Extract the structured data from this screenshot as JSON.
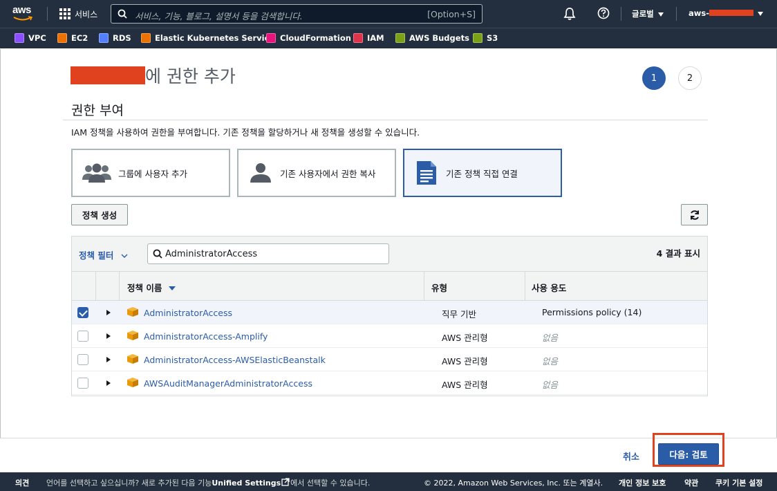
{
  "topnav": {
    "logo_text": "aws",
    "services_label": "서비스",
    "search_placeholder": "서비스, 기능, 블로그, 설명서 등을 검색합니다.",
    "search_shortcut": "[Option+S]",
    "region_label": "글로벌",
    "account_prefix": "aws-"
  },
  "favorites": [
    {
      "label": "VPC",
      "color": "#8c4fff"
    },
    {
      "label": "EC2",
      "color": "#ed7100"
    },
    {
      "label": "RDS",
      "color": "#527fff"
    },
    {
      "label": "Elastic Kubernetes Service",
      "color": "#ed7100"
    },
    {
      "label": "CloudFormation",
      "color": "#e7157b"
    },
    {
      "label": "IAM",
      "color": "#dd344c"
    },
    {
      "label": "AWS Budgets",
      "color": "#7aa116"
    },
    {
      "label": "S3",
      "color": "#7aa116"
    }
  ],
  "page": {
    "title_suffix": "에 권한 추가",
    "steps": [
      "1",
      "2"
    ],
    "section_title": "권한 부여",
    "description": "IAM 정책을 사용하여 권한을 부여합니다. 기존 정책을 할당하거나 새 정책을 생성할 수 있습니다.",
    "options": [
      {
        "label": "그룹에 사용자 추가",
        "icon": "users-group-icon",
        "selected": false
      },
      {
        "label": "기존 사용자에서 권한 복사",
        "icon": "user-icon",
        "selected": false
      },
      {
        "label": "기존 정책 직접 연결",
        "icon": "document-icon",
        "selected": true
      }
    ],
    "create_policy_label": "정책 생성"
  },
  "table": {
    "filter_label": "정책 필터",
    "search_value": "AdministratorAccess",
    "result_count": "4 결과 표시",
    "columns": [
      "정책 이름",
      "유형",
      "사용 용도"
    ],
    "rows": [
      {
        "name": "AdministratorAccess",
        "type": "직무 기반",
        "usage": "Permissions policy (14)",
        "checked": true
      },
      {
        "name": "AdministratorAccess-Amplify",
        "type": "AWS 관리형",
        "usage": "없음",
        "checked": false
      },
      {
        "name": "AdministratorAccess-AWSElasticBeanstalk",
        "type": "AWS 관리형",
        "usage": "없음",
        "checked": false
      },
      {
        "name": "AWSAuditManagerAdministratorAccess",
        "type": "AWS 관리형",
        "usage": "없음",
        "checked": false
      }
    ]
  },
  "actions": {
    "cancel_label": "취소",
    "next_label": "다음: 검토"
  },
  "footer": {
    "feedback": "의견",
    "language_text": "언어를 선택하고 싶으십니까? 새로 추가된 다음 기능",
    "unified_settings": "Unified Settings",
    "language_text_after": "에서 선택할 수 있습니다.",
    "copyright": "© 2022, Amazon Web Services, Inc. 또는 계열사.",
    "privacy": "개인 정보 보호",
    "terms": "약관",
    "cookies": "쿠키 기본 설정"
  },
  "colors": {
    "accent": "#2b5ca8",
    "nav_bg": "#232f3e",
    "highlight": "#e0421f"
  }
}
